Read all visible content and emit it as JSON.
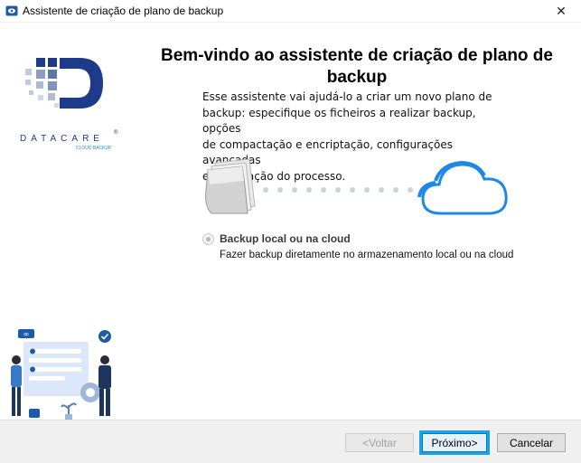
{
  "window": {
    "title": "Assistente de criação de plano de backup",
    "close_glyph": "✕"
  },
  "logo": {
    "brand": "DATACARE",
    "tagline": "CLOUD BACKUP",
    "registered": "®"
  },
  "main": {
    "heading_line1": "Bem-vindo ao assistente de criação de plano de",
    "heading_line2": "backup",
    "intro_lines": [
      "Esse assistente vai ajudá-lo a criar um novo plano de",
      "backup: especifique os ficheiros a realizar backup, opções",
      "de compactação e encriptação, configurações avançadas",
      "e automação do processo."
    ]
  },
  "option": {
    "label": "Backup local ou na cloud",
    "description": "Fazer backup diretamente no armazenamento local ou na cloud",
    "selected": true
  },
  "buttons": {
    "back": "<Voltar",
    "next": "Próximo>",
    "cancel": "Cancelar"
  },
  "colors": {
    "accent": "#1aa3e0",
    "logo_blue": "#1e3a8a",
    "cloud_blue": "#1e88e5"
  }
}
